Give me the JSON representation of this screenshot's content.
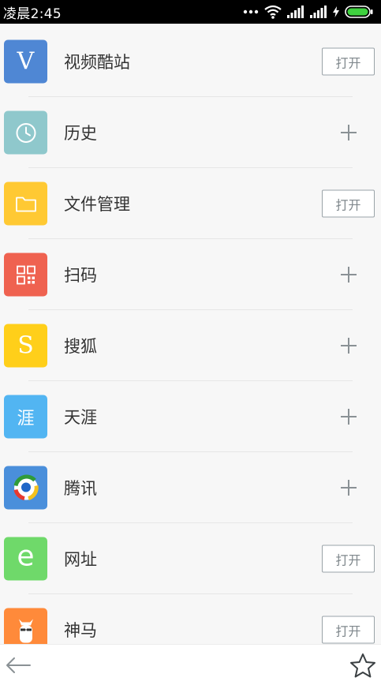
{
  "status": {
    "time": "凌晨2:45",
    "icons": [
      "more-dots-icon",
      "wifi-icon",
      "signal-icon",
      "signal-icon",
      "charging-icon",
      "battery-icon"
    ]
  },
  "items": [
    {
      "label": "视频酷站",
      "action": "open",
      "action_label": "打开",
      "icon": "v-letter-icon",
      "icon_text": "V",
      "color": "#4f87d4"
    },
    {
      "label": "历史",
      "action": "add",
      "icon": "clock-icon",
      "color": "#8fc8cc"
    },
    {
      "label": "文件管理",
      "action": "open",
      "action_label": "打开",
      "icon": "folder-icon",
      "color": "#ffc933"
    },
    {
      "label": "扫码",
      "action": "add",
      "icon": "qr-code-icon",
      "color": "#ef6250"
    },
    {
      "label": "搜狐",
      "action": "add",
      "icon": "s-letter-icon",
      "icon_text": "S",
      "color": "#ffcf1a"
    },
    {
      "label": "天涯",
      "action": "add",
      "icon": "tianya-icon",
      "icon_text": "涯",
      "color": "#52b5f2"
    },
    {
      "label": "腾讯",
      "action": "add",
      "icon": "tencent-icon",
      "color": "#4a8fdb"
    },
    {
      "label": "网址",
      "action": "open",
      "action_label": "打开",
      "icon": "e-letter-icon",
      "icon_text": "e",
      "color": "#6fd96a"
    },
    {
      "label": "神马",
      "action": "open",
      "action_label": "打开",
      "icon": "alpaca-icon",
      "color": "#ff8a3a"
    }
  ],
  "toolbar": {
    "back": "back-arrow-icon",
    "favorite": "star-icon"
  },
  "colors": {
    "background": "#f7f7f7",
    "status_bar": "#000000",
    "button_border": "#9aa3a8",
    "plus": "#8a9195"
  }
}
